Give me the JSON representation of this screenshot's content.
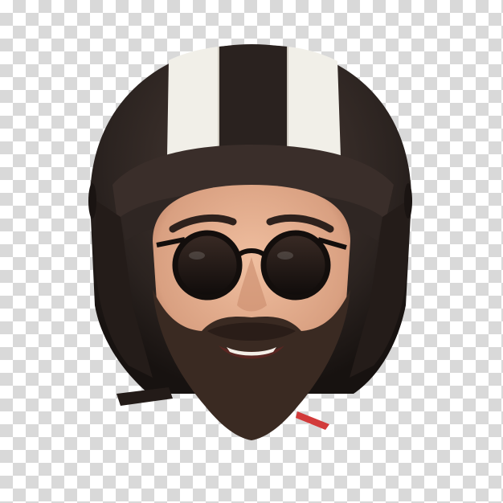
{
  "image": {
    "background": "transparency-checkerboard",
    "subject": "bearded-man-head-with-motorcycle-helmet-and-sunglasses"
  },
  "colors": {
    "checker_light": "#ffffff",
    "checker_dark": "#d9d9d9",
    "helmet_dark": "#2b2320",
    "helmet_stripe": "#f2f0ea",
    "skin": "#e0a988",
    "beard": "#3a2a22",
    "lens": "#1a1412",
    "strap_tip": "#d23a3a"
  }
}
